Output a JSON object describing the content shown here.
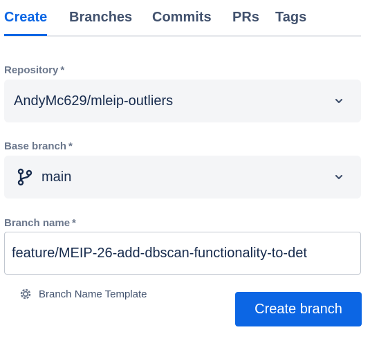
{
  "tabs": [
    {
      "label": "Create",
      "active": true
    },
    {
      "label": "Branches",
      "active": false
    },
    {
      "label": "Commits",
      "active": false
    },
    {
      "label": "PRs",
      "active": false
    },
    {
      "label": "Tags",
      "active": false
    }
  ],
  "form": {
    "repository": {
      "label": "Repository",
      "required_marker": "*",
      "value": "AndyMc629/mleip-outliers"
    },
    "base_branch": {
      "label": "Base branch",
      "required_marker": "*",
      "value": "main",
      "icon": "branch-icon"
    },
    "branch_name": {
      "label": "Branch name",
      "required_marker": "*",
      "value": "feature/MEIP-26-add-dbscan-functionality-to-det"
    },
    "template_link": {
      "label": "Branch Name Template",
      "icon": "gear-icon"
    },
    "submit_label": "Create branch"
  },
  "colors": {
    "accent": "#0c66e4",
    "label": "#6b778c",
    "text": "#172b4d",
    "field_bg": "#f4f5f7"
  }
}
